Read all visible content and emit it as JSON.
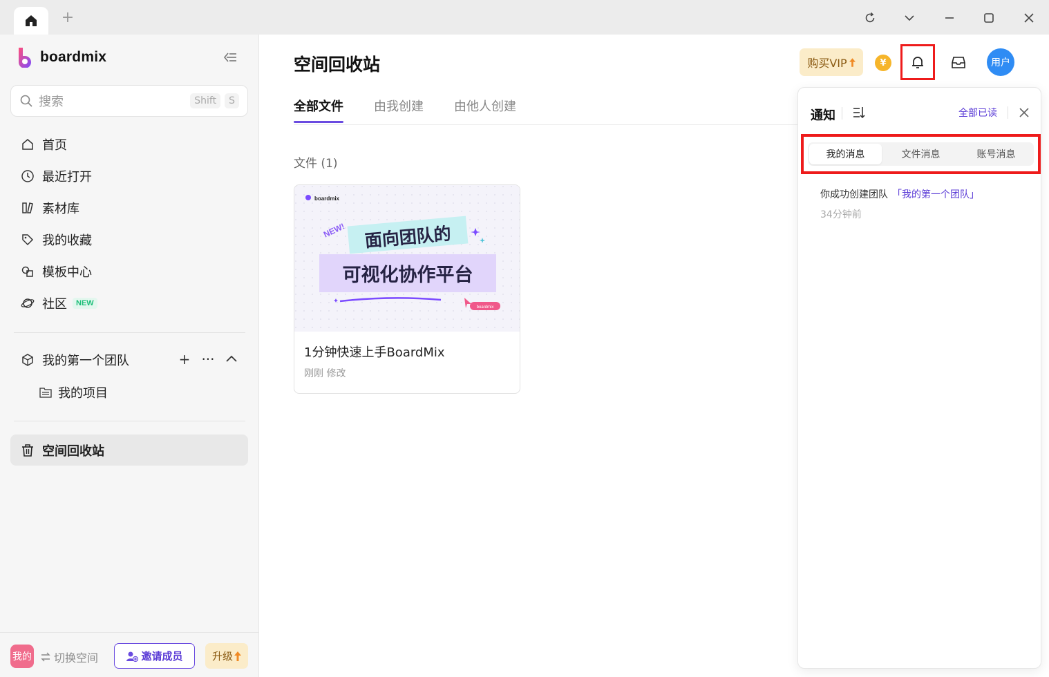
{
  "titlebar": {
    "new_tab": "+"
  },
  "sidebar": {
    "brand": "boardmix",
    "search": {
      "placeholder": "搜索",
      "shortcut_1": "Shift",
      "shortcut_2": "S"
    },
    "nav": [
      {
        "label": "首页",
        "icon": "home-icon"
      },
      {
        "label": "最近打开",
        "icon": "clock-icon"
      },
      {
        "label": "素材库",
        "icon": "library-icon"
      },
      {
        "label": "我的收藏",
        "icon": "tag-icon"
      },
      {
        "label": "模板中心",
        "icon": "template-icon"
      },
      {
        "label": "社区",
        "icon": "planet-icon",
        "badge": "NEW"
      }
    ],
    "team": {
      "label": "我的第一个团队",
      "add": "+",
      "more": "···"
    },
    "project": {
      "label": "我的项目"
    },
    "trash": {
      "label": "空间回收站"
    },
    "footer": {
      "avatar": "我的",
      "switch_space": "切换空间",
      "invite": "邀请成员",
      "upgrade": "升级"
    }
  },
  "main": {
    "title": "空间回收站",
    "tabs": [
      "全部文件",
      "由我创建",
      "由他人创建"
    ],
    "files_label": "文件 (1)",
    "file": {
      "title": "1分钟快速上手BoardMix",
      "subtitle": "刚刚 修改",
      "thumb_brand": "boardmix",
      "thumb_line1": "面向团队的",
      "thumb_line2": "可视化协作平台",
      "thumb_tag": "NEW!",
      "thumb_badge": "boardmix"
    },
    "vip": "购买VIP",
    "coin": "¥",
    "user_avatar": "用户"
  },
  "notifications": {
    "title": "通知",
    "mark_all_read": "全部已读",
    "tabs": [
      "我的消息",
      "文件消息",
      "账号消息"
    ],
    "items": [
      {
        "text": "你成功创建团队",
        "link": "「我的第一个团队」",
        "time": "34分钟前"
      }
    ]
  },
  "colors": {
    "accent": "#6a4be0",
    "highlight": "#ee1b1b",
    "vip_bg": "#fbecc9",
    "avatar_blue": "#2f8cf4"
  }
}
